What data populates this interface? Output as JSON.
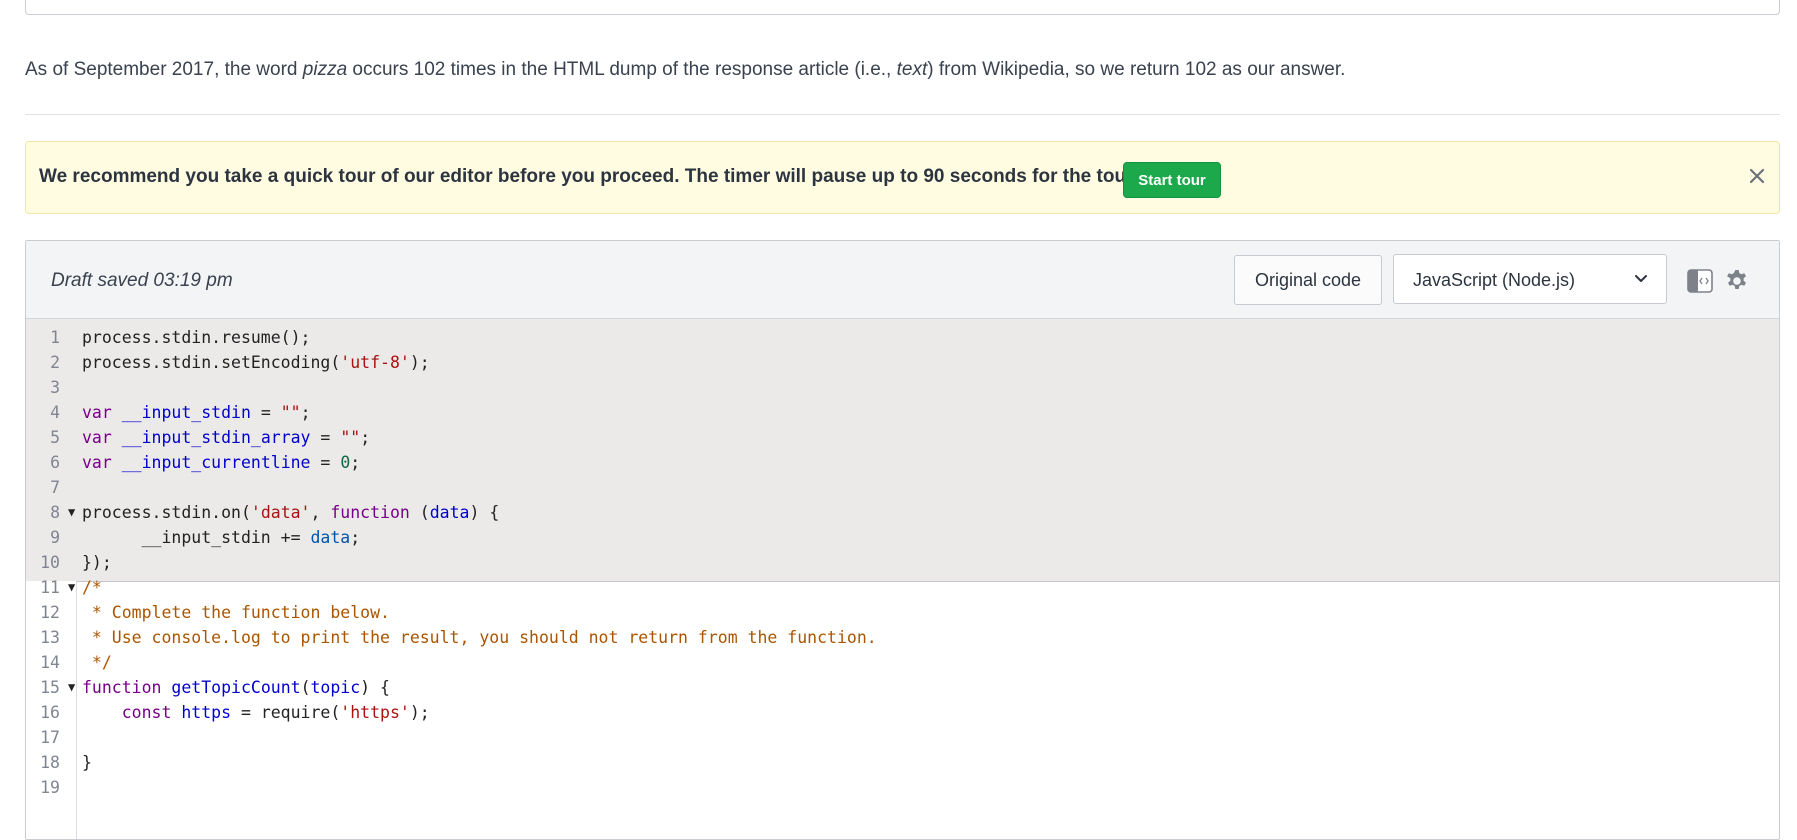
{
  "explanation": {
    "before_pizza": "As of September 2017, the word ",
    "pizza": "pizza",
    "middle": " occurs 102 times in the HTML dump of the response article (i.e., ",
    "text": "text",
    "after": ") from Wikipedia, so we return 102 as our answer."
  },
  "tour_banner": {
    "message": "We recommend you take a quick tour of our editor before you proceed. The timer will pause up to 90 seconds for the tour.",
    "start_label": "Start tour",
    "close_icon": "close-icon"
  },
  "editor": {
    "draft_status": "Draft saved 03:19 pm",
    "original_code_label": "Original code",
    "language": "JavaScript (Node.js)",
    "icons": [
      "layout-toggle-icon",
      "gear-icon",
      "chevron-down-icon"
    ],
    "lines": [
      {
        "n": "1"
      },
      {
        "n": "2"
      },
      {
        "n": "3"
      },
      {
        "n": "4"
      },
      {
        "n": "5"
      },
      {
        "n": "6"
      },
      {
        "n": "7"
      },
      {
        "n": "8"
      },
      {
        "n": "9"
      },
      {
        "n": "10"
      },
      {
        "n": "11"
      },
      {
        "n": "12"
      },
      {
        "n": "13"
      },
      {
        "n": "14"
      },
      {
        "n": "15"
      },
      {
        "n": "16"
      },
      {
        "n": "17"
      },
      {
        "n": "18"
      },
      {
        "n": "19"
      }
    ],
    "tokens": {
      "l1": "process.stdin.resume();",
      "l2a": "process.stdin.setEncoding(",
      "l2b": "'utf-8'",
      "l2c": ");",
      "var": "var",
      "l4a": "__input_stdin",
      "eq": " = ",
      "emptystr": "\"\"",
      "semi": ";",
      "l5a": "__input_stdin_array",
      "l6a": "__input_currentline",
      "zero": "0",
      "l8a": "process.stdin.on(",
      "l8b": "'data'",
      "l8c": ", ",
      "function": "function",
      "l8d": " (",
      "data": "data",
      "l8e": ") {",
      "l9a": "      __input_stdin += ",
      "l10": "});",
      "c11": "/*",
      "c12": " * Complete the function below.",
      "c13": " * Use console.log to print the result, you should not return from the function.",
      "c14": " */",
      "fname": "getTopicCount",
      "topic": "topic",
      "l15e": ") {",
      "l16a": "    const ",
      "https": "https",
      "l16b": " = require(",
      "l16c": "'https'",
      "l16d": ");",
      "l18": "}",
      "fold": "▼"
    }
  }
}
